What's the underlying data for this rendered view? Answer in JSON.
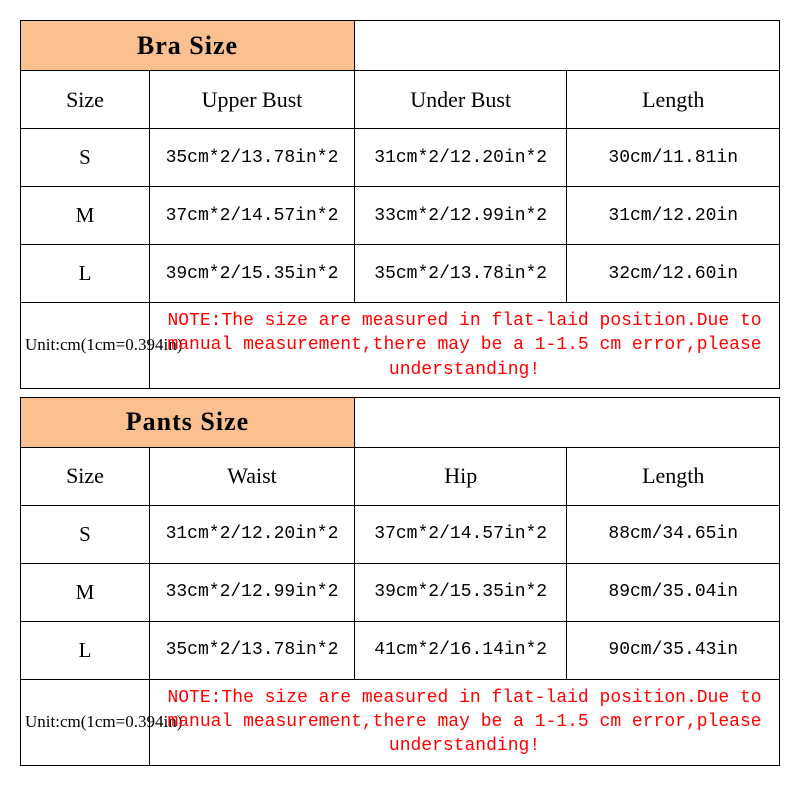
{
  "tables": {
    "bra": {
      "title": "Bra Size",
      "headers": [
        "Size",
        "Upper Bust",
        "Under Bust",
        "Length"
      ],
      "rows": [
        {
          "size": "S",
          "c1": "35cm*2/13.78in*2",
          "c2": "31cm*2/12.20in*2",
          "c3": "30cm/11.81in"
        },
        {
          "size": "M",
          "c1": "37cm*2/14.57in*2",
          "c2": "33cm*2/12.99in*2",
          "c3": "31cm/12.20in"
        },
        {
          "size": "L",
          "c1": "39cm*2/15.35in*2",
          "c2": "35cm*2/13.78in*2",
          "c3": "32cm/12.60in"
        }
      ],
      "unit": "Unit:cm(1cm=0.394in)",
      "note": "NOTE:The size are measured in flat-laid position.Due to manual measurement,there may be a 1-1.5 cm error,please understanding!"
    },
    "pants": {
      "title": "Pants Size",
      "headers": [
        "Size",
        "Waist",
        "Hip",
        "Length"
      ],
      "rows": [
        {
          "size": "S",
          "c1": "31cm*2/12.20in*2",
          "c2": "37cm*2/14.57in*2",
          "c3": "88cm/34.65in"
        },
        {
          "size": "M",
          "c1": "33cm*2/12.99in*2",
          "c2": "39cm*2/15.35in*2",
          "c3": "89cm/35.04in"
        },
        {
          "size": "L",
          "c1": "35cm*2/13.78in*2",
          "c2": "41cm*2/16.14in*2",
          "c3": "90cm/35.43in"
        }
      ],
      "unit": "Unit:cm(1cm=0.394in)",
      "note": "NOTE:The size are measured in flat-laid position.Due to manual measurement,there may be a 1-1.5 cm error,please understanding!"
    }
  }
}
